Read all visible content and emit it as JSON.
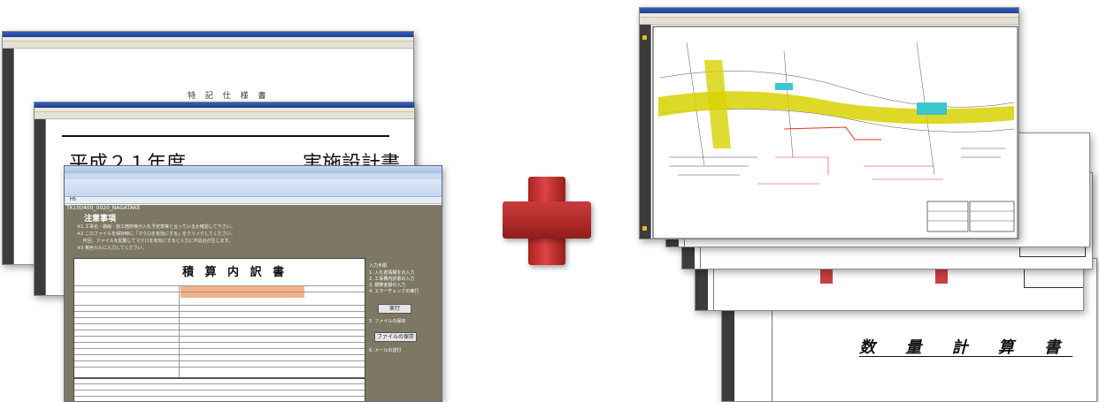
{
  "left_stack": {
    "doc1": {
      "title": "特 記 仕 様 書"
    },
    "doc2": {
      "left_title": "平成２１年度",
      "right_title": "実施設計書"
    },
    "excel": {
      "cell_ref": "H5",
      "path_line": "TK100400_0020_NAGATAKE",
      "notice_heading": "注意事項",
      "notice_lines": [
        "※1 工事名・路線・施工箇所等が入札予定表等と合っているか確認して下さい。",
        "※2 このファイルを保存時に「マクロを有効にする」をクリックしてください。",
        "　 何回、ファイルを起動してマクロを有効にすると入力に不具合が生じます。",
        "※3 黄色セルに入力してください。"
      ],
      "sheet_title": "積 算 内 訳 書",
      "side_header": "入力手順",
      "side_steps": [
        "1. 入札者情報をの入力",
        "2. 工事費内訳書の入力",
        "3. 積算金額の入力",
        "4. エラーチェックの実行"
      ],
      "button_run": "実行",
      "button_save": "ファイルの保存",
      "side_steps2": [
        "5. ファイルの保存",
        "6. メールの送付"
      ]
    }
  },
  "plus_sign": "plus",
  "right_stack": {
    "summary_title": "数 量 計 算 書"
  },
  "colors": {
    "plus_red": "#b32a2a",
    "excel_highlight": "#f4b183",
    "cad_yellow": "#d7d200",
    "cad_cyan": "#3cc6cf",
    "cad_red": "#e03030"
  }
}
